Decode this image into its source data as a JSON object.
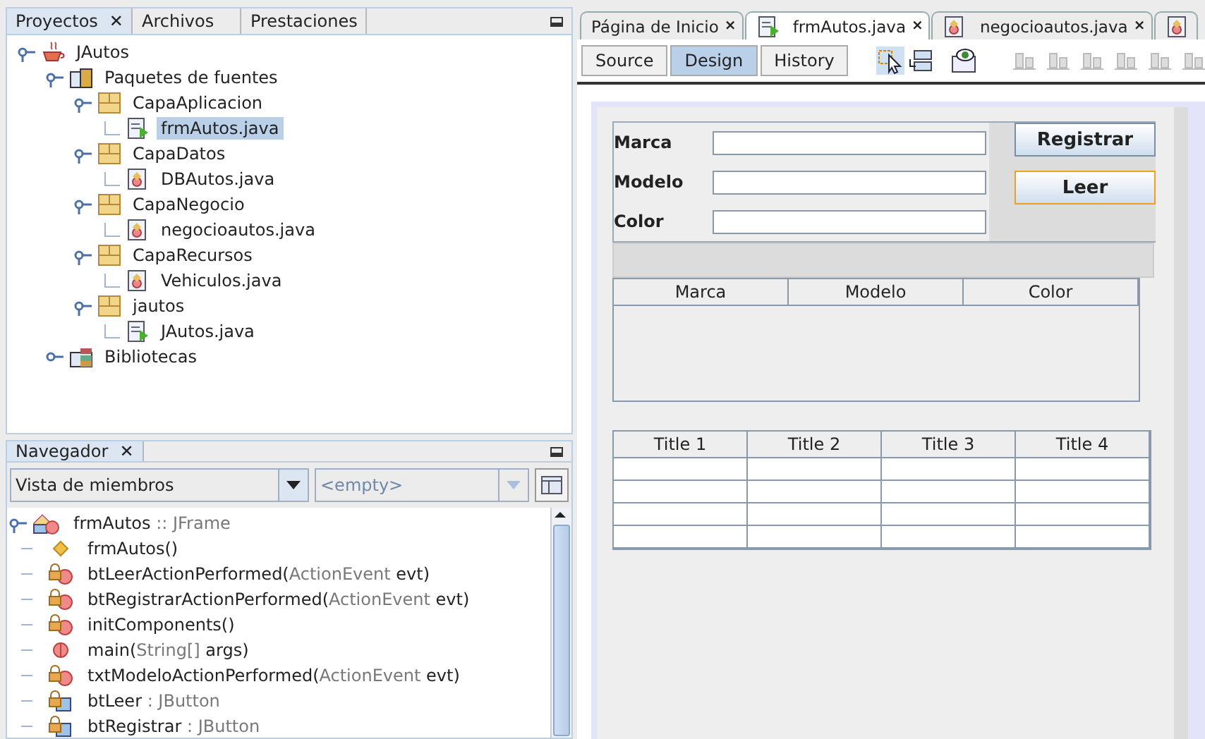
{
  "projects_panel": {
    "tabs": [
      {
        "label": "Proyectos",
        "selected": true,
        "close": "✕"
      },
      {
        "label": "Archivos",
        "selected": false
      },
      {
        "label": "Prestaciones",
        "selected": false
      }
    ],
    "tree": [
      {
        "label": "JAutos",
        "kind": "project",
        "expanded": true,
        "selected": false,
        "children": [
          {
            "label": "Paquetes de fuentes",
            "kind": "source-root",
            "expanded": true,
            "selected": false,
            "children": [
              {
                "label": "CapaAplicacion",
                "kind": "package",
                "expanded": true,
                "selected": false,
                "children": [
                  {
                    "label": "frmAutos.java",
                    "kind": "form",
                    "selected": true
                  }
                ]
              },
              {
                "label": "CapaDatos",
                "kind": "package",
                "expanded": true,
                "selected": false,
                "children": [
                  {
                    "label": "DBAutos.java",
                    "kind": "class",
                    "selected": false
                  }
                ]
              },
              {
                "label": "CapaNegocio",
                "kind": "package",
                "expanded": true,
                "selected": false,
                "children": [
                  {
                    "label": "negocioautos.java",
                    "kind": "class",
                    "selected": false
                  }
                ]
              },
              {
                "label": "CapaRecursos",
                "kind": "package",
                "expanded": true,
                "selected": false,
                "children": [
                  {
                    "label": "Vehiculos.java",
                    "kind": "class",
                    "selected": false
                  }
                ]
              },
              {
                "label": "jautos",
                "kind": "package",
                "expanded": true,
                "selected": false,
                "children": [
                  {
                    "label": "JAutos.java",
                    "kind": "main-class",
                    "selected": false
                  }
                ]
              }
            ]
          },
          {
            "label": "Bibliotecas",
            "kind": "libraries",
            "expanded": false,
            "selected": false
          }
        ]
      }
    ]
  },
  "navigator": {
    "title": "Navegador",
    "close": "✕",
    "view_select": "Vista de miembros",
    "filter_select": {
      "placeholder": "<empty>",
      "disabled": true
    },
    "members": [
      {
        "name": "frmAutos",
        "detail": " :: JFrame",
        "kind": "class"
      },
      {
        "name": "frmAutos()",
        "kind": "constructor"
      },
      {
        "name": "btLeerActionPerformed(",
        "detail": "ActionEvent",
        "tail": " evt)",
        "kind": "private-method"
      },
      {
        "name": "btRegistrarActionPerformed(",
        "detail": "ActionEvent",
        "tail": " evt)",
        "kind": "private-method"
      },
      {
        "name": "initComponents()",
        "kind": "private-method"
      },
      {
        "name": "main(",
        "detail": "String[]",
        "tail": " args)",
        "kind": "static-method"
      },
      {
        "name": "txtModeloActionPerformed(",
        "detail": "ActionEvent",
        "tail": " evt)",
        "kind": "private-method"
      },
      {
        "name": "btLeer",
        "detail": " : JButton",
        "kind": "private-field"
      },
      {
        "name": "btRegistrar",
        "detail": " : JButton",
        "kind": "private-field"
      }
    ]
  },
  "editor": {
    "tabs": [
      {
        "label": "Página de Inicio",
        "kind": "page",
        "selected": false,
        "close": "×"
      },
      {
        "label": "frmAutos.java",
        "kind": "form",
        "selected": true,
        "close": "×"
      },
      {
        "label": "negocioautos.java",
        "kind": "class",
        "selected": false,
        "close": "×"
      }
    ],
    "views": [
      {
        "label": "Source",
        "selected": false
      },
      {
        "label": "Design",
        "selected": true
      },
      {
        "label": "History",
        "selected": false
      }
    ],
    "form": {
      "fields": [
        {
          "label": "Marca"
        },
        {
          "label": "Modelo"
        },
        {
          "label": "Color"
        }
      ],
      "buttons": [
        {
          "label": "Registrar",
          "selected": false
        },
        {
          "label": "Leer",
          "selected": true
        }
      ],
      "table_1": {
        "columns": [
          "Marca",
          "Modelo",
          "Color"
        ]
      },
      "table_2": {
        "columns": [
          "Title 1",
          "Title 2",
          "Title 3",
          "Title 4"
        ]
      }
    }
  }
}
